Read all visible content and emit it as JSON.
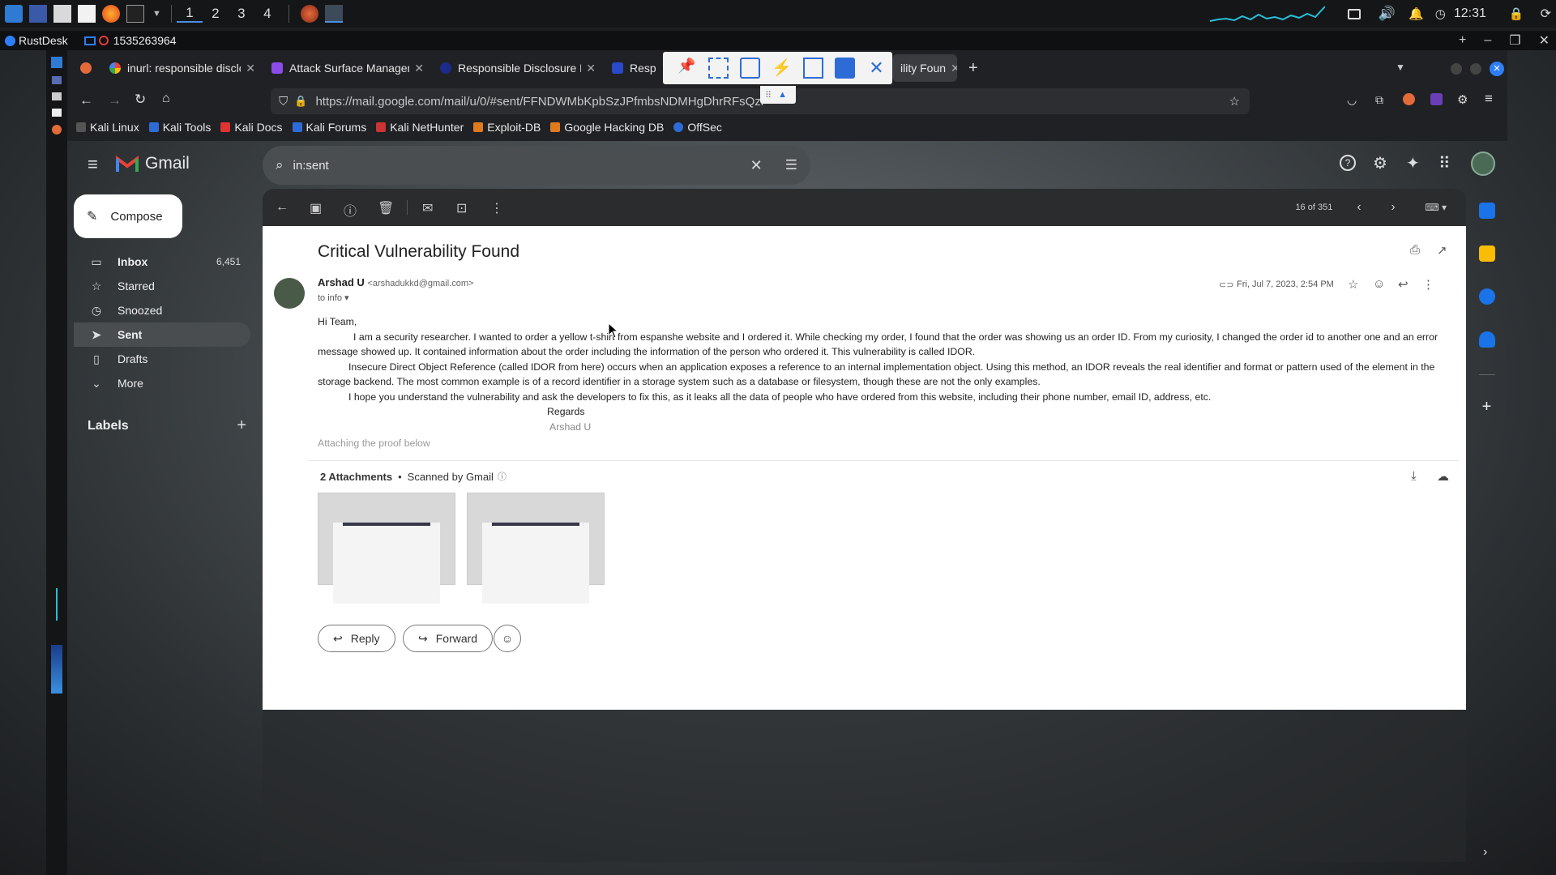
{
  "taskbar": {
    "workspaces": [
      "1",
      "2",
      "3",
      "4"
    ],
    "clock": "12:31"
  },
  "rustdesk": {
    "app": "RustDesk",
    "session_id": "1535263964"
  },
  "browser": {
    "tabs": [
      {
        "label": "inurl: responsible disclos",
        "favicon": "google"
      },
      {
        "label": "Attack Surface Manageme",
        "favicon": "asm"
      },
      {
        "label": "Responsible Disclosure P",
        "favicon": "rd"
      },
      {
        "label": "Resp",
        "favicon": "rd2"
      },
      {
        "label": "ility Foun",
        "favicon": "gmail"
      }
    ],
    "url": "https://mail.google.com/mail/u/0/#sent/FFNDWMbKpbSzJPfmbsNDMHgDhrRFsQzr",
    "bookmarks": [
      "Kali Linux",
      "Kali Tools",
      "Kali Docs",
      "Kali Forums",
      "Kali NetHunter",
      "Exploit-DB",
      "Google Hacking DB",
      "OffSec"
    ]
  },
  "gmail": {
    "logo": "Gmail",
    "search_value": "in:sent",
    "compose": "Compose",
    "nav": [
      {
        "label": "Inbox",
        "count": "6,451",
        "icon": "inbox-icon"
      },
      {
        "label": "Starred",
        "count": "",
        "icon": "star-icon"
      },
      {
        "label": "Snoozed",
        "count": "",
        "icon": "clock-icon"
      },
      {
        "label": "Sent",
        "count": "",
        "icon": "send-icon"
      },
      {
        "label": "Drafts",
        "count": "",
        "icon": "draft-icon"
      },
      {
        "label": "More",
        "count": "",
        "icon": "chevron-down-icon"
      }
    ],
    "labels_heading": "Labels",
    "pagination": "16 of 351"
  },
  "email": {
    "subject": "Critical Vulnerability Found",
    "sender_name": "Arshad U",
    "sender_email": "<arshadukkd@gmail.com>",
    "to": "to info",
    "date": "Fri, Jul 7, 2023, 2:54 PM",
    "greeting": "Hi Team,",
    "para1": "I am a security researcher. I wanted to order a yellow t-shirt from espanshe website and I ordered it. While checking my order, I found that the order was showing us an order ID. From my curiosity, I changed the order id to another one and an error message showed up. It contained information about the order including the information of the person who ordered it. This vulnerability is called IDOR.",
    "para2": "Insecure Direct Object Reference (called IDOR from here) occurs when an application exposes a reference to an internal implementation object. Using this method, an IDOR reveals the real identifier and format or pattern used of the element in the storage backend. The most common example is of a record identifier in a storage system such as a database or filesystem, though these are not the only examples.",
    "para3": "I hope you understand the vulnerability and ask the developers to fix this, as it leaks all the data of people who have ordered from this website, including their phone number, email ID, address, etc.",
    "regards": "Regards",
    "signature": "Arshad U",
    "proof_note": "Attaching the proof below",
    "attachments_label": "2 Attachments",
    "scanned": "Scanned by Gmail",
    "reply": "Reply",
    "forward": "Forward"
  }
}
